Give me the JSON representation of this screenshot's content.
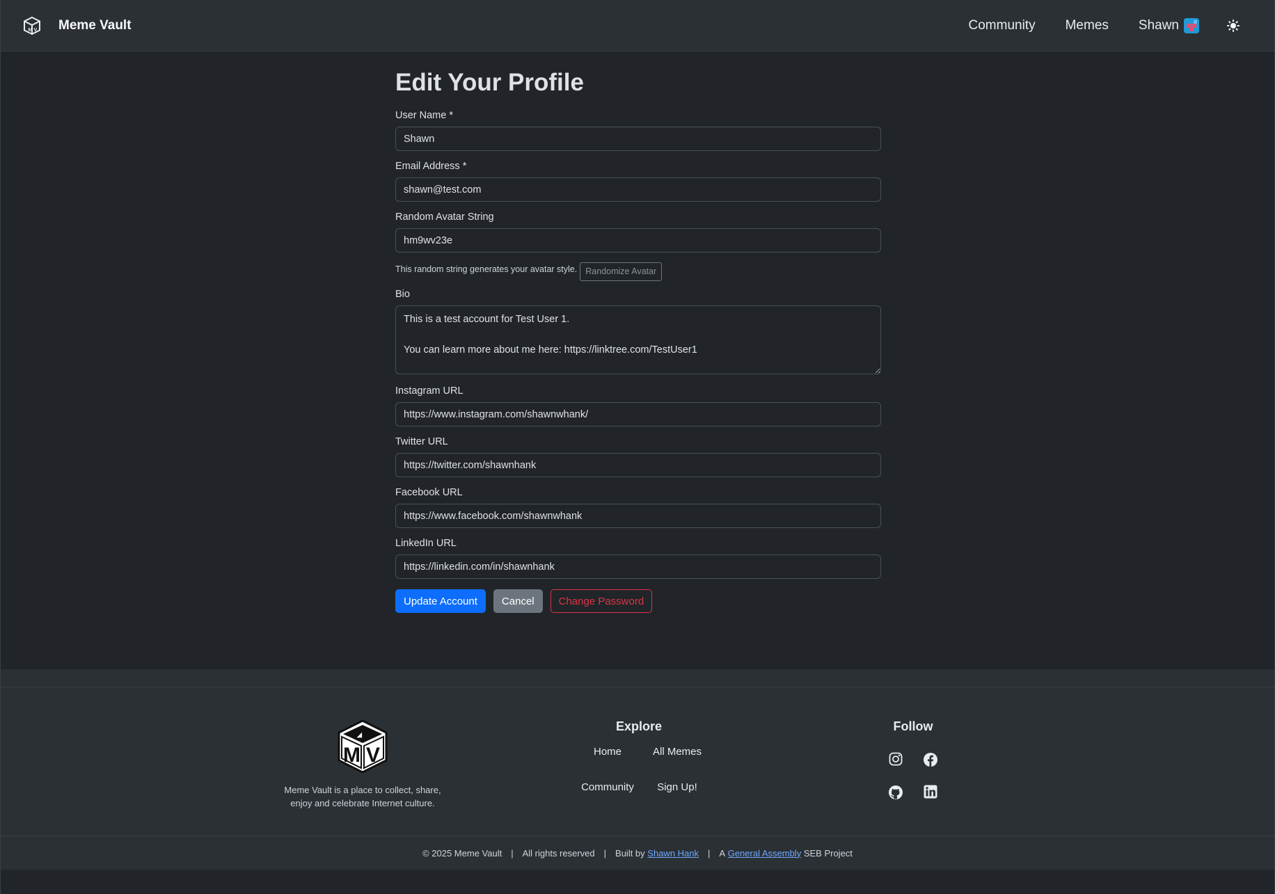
{
  "navbar": {
    "brand": "Meme Vault",
    "links": [
      "Community",
      "Memes"
    ],
    "user_name": "Shawn"
  },
  "form": {
    "title": "Edit Your Profile",
    "username": {
      "label": "User Name *",
      "value": "Shawn"
    },
    "email": {
      "label": "Email Address *",
      "value": "shawn@test.com"
    },
    "avatar": {
      "label": "Random Avatar String",
      "value": "hm9wv23e",
      "help": "This random string generates your avatar style.",
      "randomize_label": "Randomize Avatar"
    },
    "bio": {
      "label": "Bio",
      "value": "This is a test account for Test User 1.\n\nYou can learn more about me here: https://linktree.com/TestUser1"
    },
    "instagram": {
      "label": "Instagram URL",
      "value": "https://www.instagram.com/shawnwhank/"
    },
    "twitter": {
      "label": "Twitter URL",
      "value": "https://twitter.com/shawnhank"
    },
    "facebook": {
      "label": "Facebook URL",
      "value": "https://www.facebook.com/shawnwhank"
    },
    "linkedin": {
      "label": "LinkedIn URL",
      "value": "https://linkedin.com/in/shawnhank"
    },
    "buttons": {
      "update": "Update Account",
      "cancel": "Cancel",
      "change_password": "Change Password"
    }
  },
  "footer": {
    "about_line1": "Meme Vault is a place to collect, share,",
    "about_line2": "enjoy and celebrate Internet culture.",
    "explore": {
      "heading": "Explore",
      "links": [
        "Home",
        "All Memes",
        "Community",
        "Sign Up!"
      ]
    },
    "follow": {
      "heading": "Follow",
      "icons": [
        "instagram-icon",
        "facebook-icon",
        "github-icon",
        "linkedin-icon"
      ]
    },
    "copyright": {
      "text": "© 2025 Meme Vault",
      "rights": "All rights reserved",
      "built_by": "Built by",
      "author": "Shawn Hank",
      "project_prefix": "A",
      "org": "General Assembly",
      "project_suffix": "SEB Project"
    }
  },
  "colors": {
    "background": "#212529",
    "navbar": "#2b3035",
    "primary": "#0d6efd",
    "secondary": "#6c757d",
    "danger": "#dc3545",
    "link": "#6ea8fe"
  }
}
